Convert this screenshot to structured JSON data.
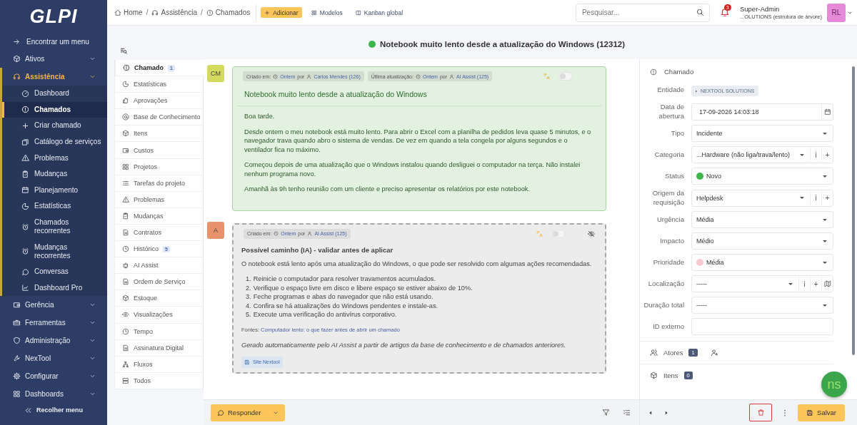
{
  "sidebar": {
    "logo": "GLPI",
    "find_menu": "Encontrar um menu",
    "sections": [
      {
        "label": "Ativos",
        "expanded": false,
        "selected": false
      },
      {
        "label": "Assistência",
        "expanded": true,
        "selected": true,
        "children": [
          {
            "label": "Dashboard",
            "selected": false
          },
          {
            "label": "Chamados",
            "selected": true
          },
          {
            "label": "Criar chamado",
            "selected": false
          },
          {
            "label": "Catálogo de serviços",
            "selected": false
          },
          {
            "label": "Problemas",
            "selected": false
          },
          {
            "label": "Mudanças",
            "selected": false
          },
          {
            "label": "Planejamento",
            "selected": false
          },
          {
            "label": "Estatísticas",
            "selected": false
          },
          {
            "label": "Chamados recorrentes",
            "selected": false
          },
          {
            "label": "Mudanças recorrentes",
            "selected": false
          },
          {
            "label": "Conversas",
            "selected": false
          },
          {
            "label": "Dashboard Pro",
            "selected": false
          }
        ]
      },
      {
        "label": "Gerência",
        "expanded": false,
        "selected": false
      },
      {
        "label": "Ferramentas",
        "expanded": false,
        "selected": false
      },
      {
        "label": "Administração",
        "expanded": false,
        "selected": false
      },
      {
        "label": "NexTool",
        "expanded": false,
        "selected": false
      },
      {
        "label": "Configurar",
        "expanded": false,
        "selected": false
      },
      {
        "label": "Dashboards",
        "expanded": false,
        "selected": false
      }
    ],
    "collapse": "Recolher menu"
  },
  "topbar": {
    "breadcrumbs": [
      "Home",
      "Assistência",
      "Chamados"
    ],
    "separator": "/",
    "actions": [
      {
        "label": "Adicionar",
        "kind": "primary"
      },
      {
        "label": "Modelos",
        "kind": "link"
      },
      {
        "label": "Kanban global",
        "kind": "link"
      }
    ],
    "search": {
      "placeholder": "Pesquisar..."
    },
    "notifications": "3",
    "user": {
      "name": "Super-Admin",
      "entity": "...OLUTIONS (estrutura de árvore)",
      "initials": "RL"
    }
  },
  "ticket": {
    "title": "Notebook muito lento desde a atualização do Windows (12312)",
    "color": "#3cb54a"
  },
  "tabs": [
    {
      "label": "Chamado",
      "count": "1",
      "selected": true
    },
    {
      "label": "Estatísticas",
      "selected": false
    },
    {
      "label": "Aprovações",
      "selected": false
    },
    {
      "label": "Base de Conhecimento",
      "selected": false
    },
    {
      "label": "Itens",
      "selected": false
    },
    {
      "label": "Custos",
      "selected": false
    },
    {
      "label": "Projetos",
      "selected": false
    },
    {
      "label": "Tarefas do projeto",
      "selected": false
    },
    {
      "label": "Problemas",
      "selected": false
    },
    {
      "label": "Mudanças",
      "selected": false
    },
    {
      "label": "Contratos",
      "selected": false
    },
    {
      "label": "Histórico",
      "count": "5",
      "selected": false
    },
    {
      "label": "AI Assist",
      "selected": false
    },
    {
      "label": "Ordem de Serviço",
      "selected": false
    },
    {
      "label": "Estoque",
      "selected": false
    },
    {
      "label": "Visualizações",
      "selected": false
    },
    {
      "label": "Tempo",
      "selected": false
    },
    {
      "label": "Assinatura Digital",
      "selected": false
    },
    {
      "label": "Fluxos",
      "selected": false
    },
    {
      "label": "Todos",
      "selected": false
    }
  ],
  "timeline": [
    {
      "kind": "ticket",
      "avatar": "CM",
      "color": "#d3da5e",
      "on": false,
      "meta": [
        {
          "label": "Criado em:",
          "when": "Ontem",
          "by": "por",
          "who": "Carlos Mendes (126)"
        },
        {
          "label": "Última atualização:",
          "when": "Ontem",
          "by": "por",
          "who": "AI Assist (125)"
        }
      ],
      "title": "Notebook muito lento desde a atualização do Windows",
      "paragraphs": [
        "Boa tarde.",
        "Desde ontem o meu notebook está muito lento. Para abrir o Excel com a planilha de pedidos leva quase 5 minutos, e o navegador trava quando abro o sistema de vendas. De vez em quando a tela congela por alguns segundos e o ventilador fica no máximo.",
        "Começou depois de uma atualização que o Windows instalou quando desliguei o computador na terça. Não instalei nenhum programa novo.",
        "Amanhã às 9h tenho reunião com um cliente e preciso apresentar os relatórios por este notebook."
      ]
    },
    {
      "kind": "ai",
      "avatar": "A",
      "color": "#e8926c",
      "on": false,
      "meta": [
        {
          "label": "Criado em:",
          "when": "Ontem",
          "by": "por",
          "who": "AI Assist (125)"
        }
      ],
      "title": "Possível caminho (IA) - validar antes de aplicar",
      "paragraphs": [
        "O notebook está lento após uma atualização do Windows, o que pode ser resolvido com algumas ações recomendadas."
      ],
      "steps": [
        {
          "number": "1.",
          "text": "Reinicie o computador para resolver travamentos acumulados."
        },
        {
          "number": "2.",
          "text": "Verifique o espaço livre em disco e libere espaço se estiver abaixo de 10%."
        },
        {
          "number": "3.",
          "text": "Feche programas e abas do navegador que não está usando."
        },
        {
          "number": "4.",
          "text": "Confira se há atualizações do Windows pendentes e instale-as."
        },
        {
          "number": "5.",
          "text": "Execute uma verificação do antivírus corporativo."
        }
      ],
      "sources": {
        "label": "Fontes:",
        "link": "Computador lento: o que fazer antes de abrir um chamado"
      },
      "note": "Gerado automaticamente pelo AI Assist a partir de artigos da base de conhecimento e de chamados anteriores.",
      "tag": "Site Nextool"
    }
  ],
  "details": {
    "heading": "Chamado",
    "fields": [
      {
        "label": "Entidade",
        "kind": "entity",
        "value": "NEXTOOL SOLUTIONS"
      },
      {
        "label": "Data de abertura",
        "kind": "date",
        "value": "17-09-2026 14:03:18"
      },
      {
        "label": "Tipo",
        "kind": "select",
        "value": "Incidente"
      },
      {
        "label": "Categoria",
        "kind": "select",
        "value": "...Hardware (não liga/trava/lento)",
        "actions": [
          {
            "kind": "text",
            "label": "i"
          },
          {
            "kind": "text",
            "label": "+"
          }
        ]
      },
      {
        "label": "Status",
        "kind": "select",
        "value": "Novo",
        "color": "#3cb54a"
      },
      {
        "label": "Origem da requisição",
        "kind": "select",
        "value": "Helpdesk",
        "actions": [
          {
            "kind": "text",
            "label": "i"
          },
          {
            "kind": "text",
            "label": "+"
          }
        ]
      },
      {
        "label": "Urgência",
        "kind": "select",
        "value": "Média"
      },
      {
        "label": "Impacto",
        "kind": "select",
        "value": "Médio"
      },
      {
        "label": "Prioridade",
        "kind": "select",
        "value": "Média",
        "color": "#f8c9d0"
      },
      {
        "label": "Localização",
        "kind": "select",
        "value": "-----",
        "actions": [
          {
            "kind": "text",
            "label": "i"
          },
          {
            "kind": "text",
            "label": "+"
          },
          {
            "kind": "map"
          }
        ]
      },
      {
        "label": "Duração total",
        "kind": "select",
        "value": "-----"
      },
      {
        "label": "ID externo",
        "kind": "input"
      }
    ],
    "sections": [
      {
        "label": "Atores",
        "count": "1"
      },
      {
        "label": "Itens",
        "count": "0"
      }
    ],
    "badge": "ns"
  },
  "footer": {
    "reply": "Responder",
    "save": "Salvar"
  }
}
